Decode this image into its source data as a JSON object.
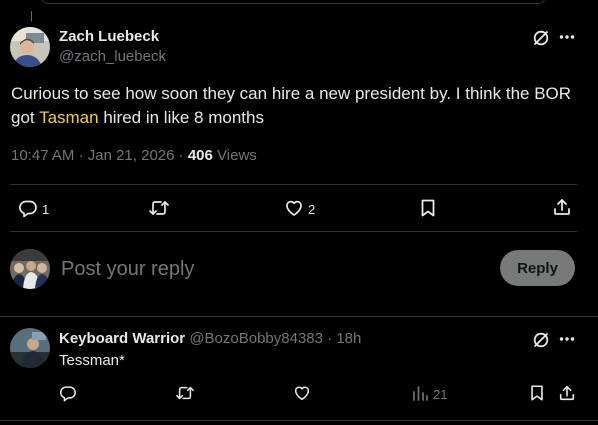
{
  "top_marker": "|",
  "post": {
    "author_name": "Zach Luebeck",
    "author_handle": "@zach_luebeck",
    "text_before": "Curious to see how soon they can hire a new president by. I think the BOR got ",
    "text_highlight": "Tasman",
    "text_after": " hired in like 8 months",
    "time": "10:47 AM",
    "date": "Jan 21, 2026",
    "dot": "·",
    "views_count": "406",
    "views_label": "Views",
    "reply_count": "1",
    "like_count": "2"
  },
  "composer": {
    "placeholder": "Post your reply",
    "reply_button": "Reply"
  },
  "reply": {
    "author_name": "Keyboard Warrior",
    "author_handle": "@BozoBobby84383",
    "dot": "·",
    "age": "18h",
    "text": "Tessman*",
    "views_count": "21"
  },
  "colors": {
    "background": "#000000",
    "text": "#e7e9ea",
    "muted": "#71767b",
    "highlight": "#f4d03f",
    "reply_button_bg": "#787a7a",
    "reply_button_text": "#0f1419"
  },
  "icons": [
    "grok-icon",
    "more-icon",
    "reply-icon",
    "retweet-icon",
    "like-icon",
    "bookmark-icon",
    "share-icon",
    "views-icon"
  ]
}
